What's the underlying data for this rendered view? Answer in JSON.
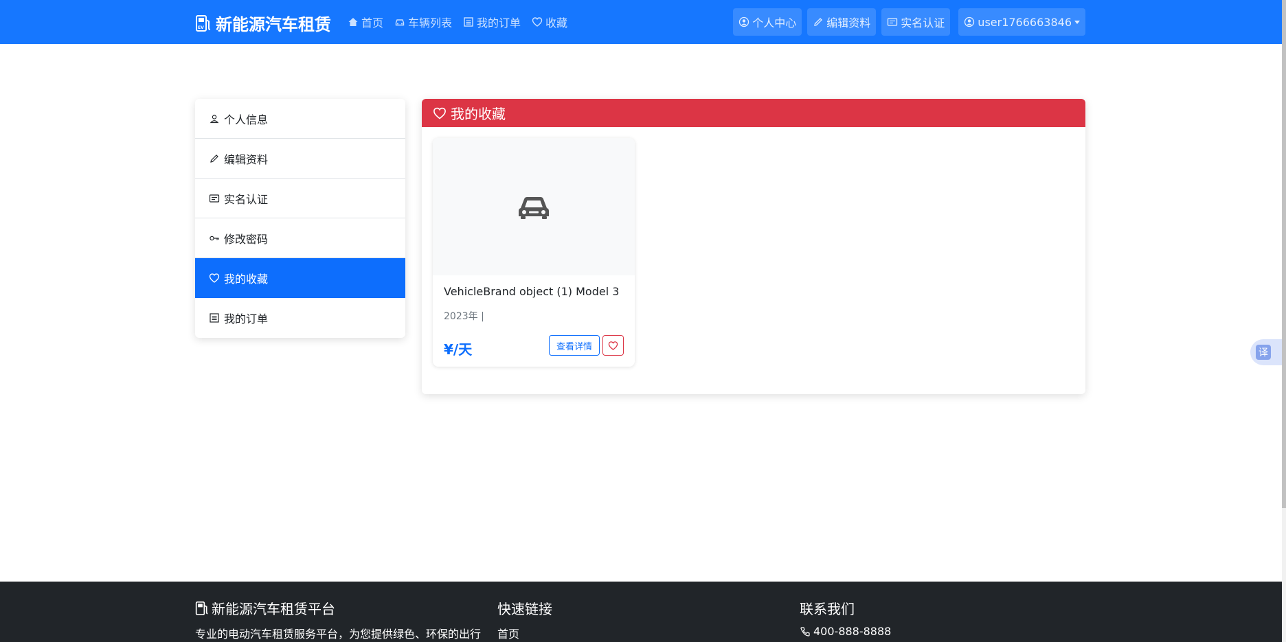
{
  "navbar": {
    "brand": "新能源汽车租赁",
    "links": [
      {
        "label": "首页",
        "icon": "house-icon"
      },
      {
        "label": "车辆列表",
        "icon": "car-icon"
      },
      {
        "label": "我的订单",
        "icon": "list-icon"
      },
      {
        "label": "收藏",
        "icon": "heart-icon"
      }
    ],
    "right_buttons": [
      {
        "label": "个人中心",
        "icon": "person-circle-icon"
      },
      {
        "label": "编辑资料",
        "icon": "pencil-icon"
      },
      {
        "label": "实名认证",
        "icon": "card-icon"
      }
    ],
    "user": "user1766663846"
  },
  "sidebar": {
    "items": [
      {
        "label": "个人信息",
        "icon": "person-icon"
      },
      {
        "label": "编辑资料",
        "icon": "pencil-icon"
      },
      {
        "label": "实名认证",
        "icon": "card-icon"
      },
      {
        "label": "修改密码",
        "icon": "key-icon"
      },
      {
        "label": "我的收藏",
        "icon": "heart-icon",
        "active": true
      },
      {
        "label": "我的订单",
        "icon": "receipt-icon"
      }
    ]
  },
  "favorites": {
    "title": "我的收藏",
    "cards": [
      {
        "name": "VehicleBrand object (1) Model 3",
        "meta": "2023年 |",
        "price": "¥/天",
        "detail_label": "查看详情"
      }
    ]
  },
  "translate": {
    "label": "译"
  },
  "footer": {
    "brand_title": "新能源汽车租赁平台",
    "brand_desc": "专业的电动汽车租赁服务平台，为您提供绿色、环保的出行",
    "links_title": "快速链接",
    "links": [
      "首页"
    ],
    "contact_title": "联系我们",
    "phone": "400-888-8888"
  },
  "colors": {
    "navbar": "#1677ff",
    "primary": "#0d6efd",
    "danger": "#dc3545",
    "footer": "#212529"
  }
}
